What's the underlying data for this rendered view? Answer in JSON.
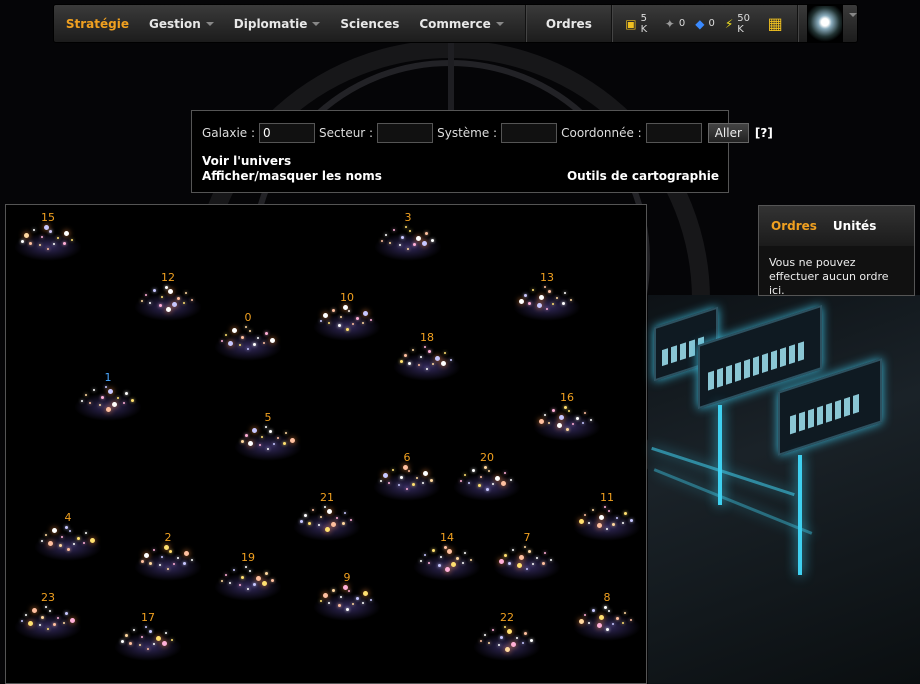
{
  "nav": {
    "items": [
      {
        "label": "Stratégie",
        "active": true,
        "dropdown": false
      },
      {
        "label": "Gestion",
        "active": false,
        "dropdown": true
      },
      {
        "label": "Diplomatie",
        "active": false,
        "dropdown": true
      },
      {
        "label": "Sciences",
        "active": false,
        "dropdown": false
      },
      {
        "label": "Commerce",
        "active": false,
        "dropdown": true
      }
    ],
    "orders_label": "Ordres",
    "resources": [
      {
        "icon": "credits-icon",
        "value": "5 K"
      },
      {
        "icon": "ship-icon",
        "value": "0"
      },
      {
        "icon": "crystal-icon",
        "value": "0"
      },
      {
        "icon": "energy-icon",
        "value": "50 K"
      }
    ]
  },
  "search": {
    "galaxie_label": "Galaxie :",
    "galaxie_value": "0",
    "secteur_label": "Secteur :",
    "systeme_label": "Système :",
    "coord_label": "Coordonnée :",
    "go_label": "Aller",
    "help_label": "[?]",
    "link_universe": "Voir l'univers",
    "link_names": "Afficher/masquer les noms",
    "link_tools": "Outils de cartographie"
  },
  "map": {
    "current_sector": "1",
    "sectors": [
      "15",
      "3",
      "12",
      "13",
      "0",
      "10",
      "18",
      "1",
      "16",
      "5",
      "6",
      "20",
      "21",
      "11",
      "4",
      "2",
      "19",
      "14",
      "7",
      "23",
      "9",
      "17",
      "22",
      "8"
    ]
  },
  "orders_panel": {
    "tab_orders": "Ordres",
    "tab_units": "Unités",
    "message": "Vous ne pouvez effectuer aucun ordre ici."
  },
  "colors": {
    "accent": "#f0a020",
    "current": "#4aa8ff",
    "station_glow": "#3fd0f0"
  }
}
